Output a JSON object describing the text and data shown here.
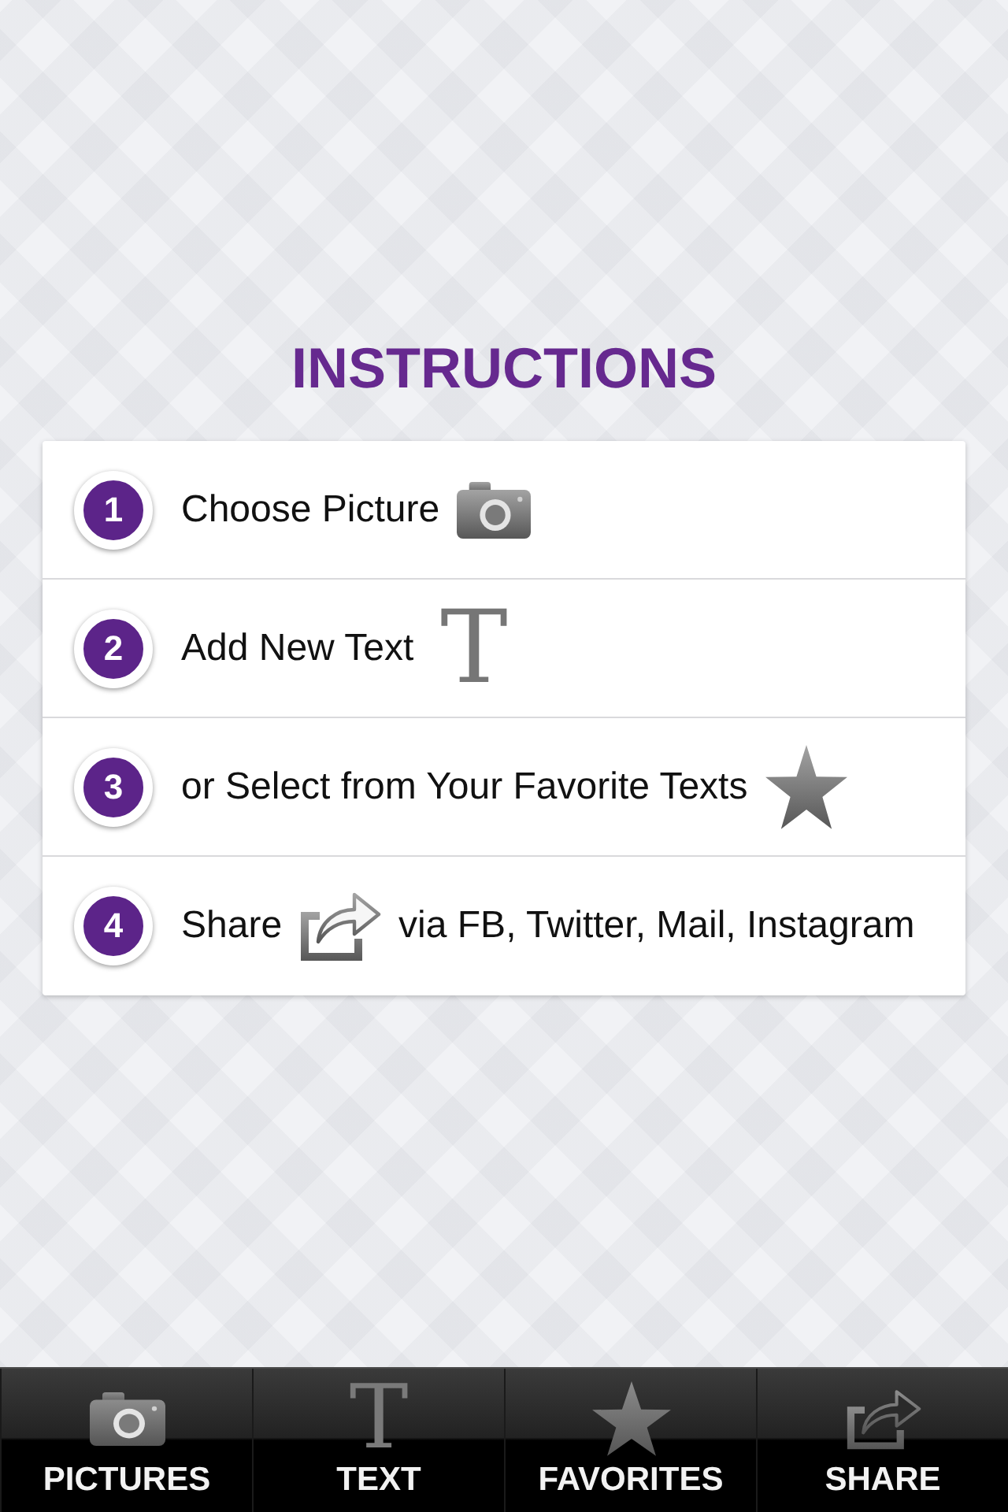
{
  "title": "INSTRUCTIONS",
  "steps": [
    {
      "number": "1",
      "text": "Choose Picture"
    },
    {
      "number": "2",
      "text": "Add New Text",
      "glyph": "T"
    },
    {
      "number": "3",
      "text": "or Select from Your Favorite Texts"
    },
    {
      "number": "4",
      "text": "Share",
      "after": "via FB, Twitter, Mail, Instagram"
    }
  ],
  "toolbar": [
    {
      "label": "PICTURES"
    },
    {
      "label": "TEXT",
      "glyph": "T"
    },
    {
      "label": "FAVORITES"
    },
    {
      "label": "SHARE"
    }
  ]
}
